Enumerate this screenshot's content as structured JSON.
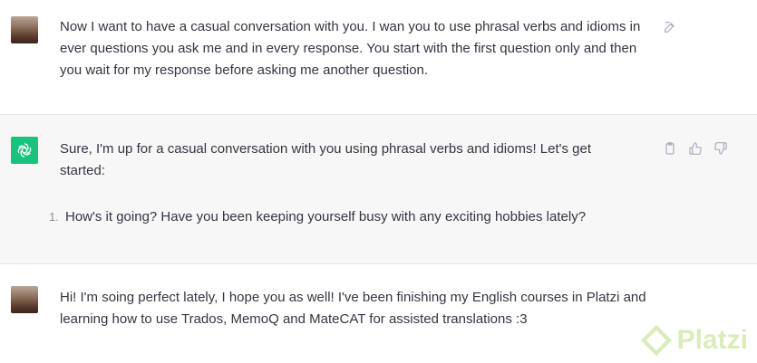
{
  "conversation": {
    "user_message_1": {
      "text": "Now I want to have a casual conversation with you. I wan you to use phrasal verbs and idioms in ever questions you ask me and in every response. You start with the first question only and then you wait for my response before asking me another question.",
      "edit_icon": "edit-icon"
    },
    "assistant_message_1": {
      "intro": "Sure, I'm up for a casual conversation with you using phrasal verbs and idioms! Let's get started:",
      "list": [
        {
          "num": "1.",
          "text": "How's it going? Have you been keeping yourself busy with any exciting hobbies lately?"
        }
      ],
      "actions": [
        "clipboard-icon",
        "thumbs-up-icon",
        "thumbs-down-icon"
      ]
    },
    "user_message_2": {
      "text": "Hi! I'm soing perfect lately, I hope you as well! I've been finishing my English courses in Platzi and learning how to use Trados, MemoQ and MateCAT for assisted translations :3"
    }
  },
  "watermark": {
    "label": "Platzi",
    "color": "#98ca3f"
  },
  "colors": {
    "assistant_bg": "#f7f7f8",
    "gpt_green": "#19c37d",
    "text": "#343541",
    "icon": "#acacbe"
  }
}
